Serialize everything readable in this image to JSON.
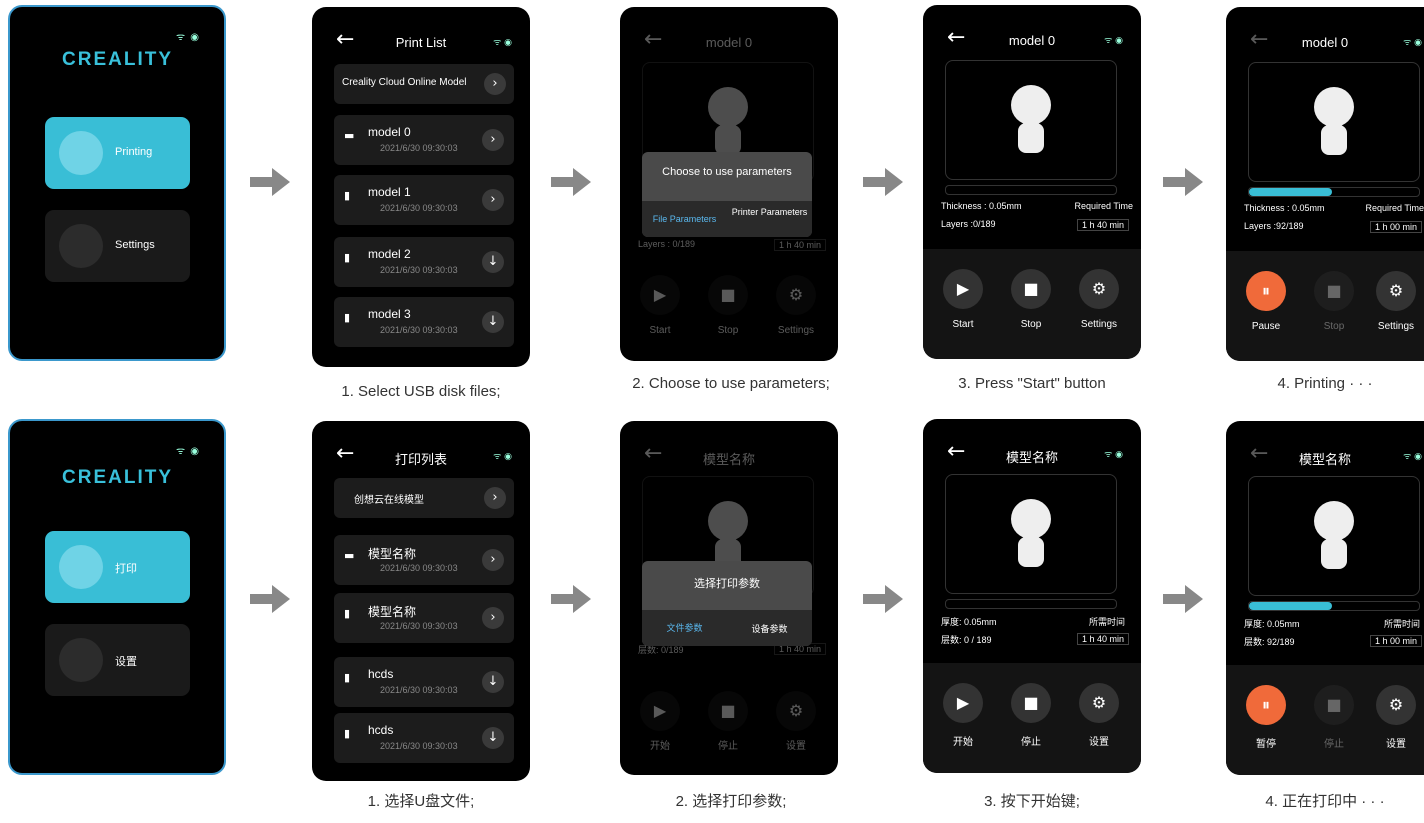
{
  "brand": "CREALITY",
  "wifi": "ᯤ ◉",
  "rows": {
    "english": {
      "home": {
        "printing": "Printing",
        "settings": "Settings"
      },
      "list": {
        "title": "Print List",
        "cloud": "Creality Cloud Online Model",
        "items": [
          {
            "name": "model 0",
            "date": "2021/6/30   09:30:03"
          },
          {
            "name": "model 1",
            "date": "2021/6/30   09:30:03"
          },
          {
            "name": "model 2",
            "date": "2021/6/30   09:30:03"
          },
          {
            "name": "model 3",
            "date": "2021/6/30   09:30:03"
          }
        ]
      },
      "model_title": "model 0",
      "dialog": {
        "title": "Choose to use parameters",
        "file": "File Parameters",
        "printer": "Printer Parameters"
      },
      "info": {
        "thickness": "Thickness : 0.05mm",
        "required": "Required Time",
        "layers_start": "Layers :0/189",
        "time_start": "1 h 40 min",
        "layers_print": "Layers :92/189",
        "time_print": "1 h 00 min",
        "layers_dim": "Layers : 0/189",
        "time_dim": "1 h 40 min"
      },
      "controls": {
        "start": "Start",
        "stop": "Stop",
        "settings": "Settings",
        "pause": "Pause"
      },
      "captions": [
        "1. Select USB disk files;",
        "2.  Choose to use parameters;",
        "3. Press \"Start\" button",
        "4.  Printing · · ·"
      ]
    },
    "chinese": {
      "home": {
        "printing": "打印",
        "settings": "设置"
      },
      "list": {
        "title": "打印列表",
        "cloud": "创想云在线模型",
        "items": [
          {
            "name": "模型名称",
            "date": "2021/6/30   09:30:03"
          },
          {
            "name": "模型名称",
            "date": "2021/6/30   09:30:03"
          },
          {
            "name": "hcds",
            "date": "2021/6/30   09:30:03"
          },
          {
            "name": "hcds",
            "date": "2021/6/30   09:30:03"
          }
        ]
      },
      "model_title": "模型名称",
      "dialog": {
        "title": "选择打印参数",
        "file": "文件参数",
        "printer": "设备参数"
      },
      "info": {
        "thickness": "厚度: 0.05mm",
        "required": "所需时间",
        "layers_start": "层数: 0 / 189",
        "time_start": "1 h 40 min",
        "layers_print": "层数: 92/189",
        "time_print": "1 h 00 min",
        "layers_dim": "层数: 0/189",
        "time_dim": "1 h 40 min"
      },
      "controls": {
        "start": "开始",
        "stop": "停止",
        "settings": "设置",
        "pause": "暂停"
      },
      "captions": [
        "1. 选择U盘文件;",
        "2.  选择打印参数;",
        "3.  按下开始键;",
        "4.  正在打印中 · · ·"
      ]
    }
  },
  "progress": {
    "english": 0.49,
    "chinese": 0.49
  },
  "accent_color": "#39bed6",
  "pause_color": "#f06a3a"
}
